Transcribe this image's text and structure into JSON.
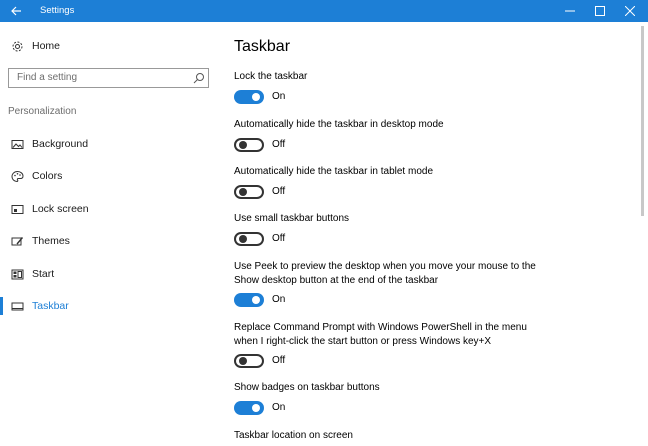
{
  "window": {
    "title": "Settings",
    "accent": "#1d7fd6"
  },
  "sidebar": {
    "home_label": "Home",
    "search_placeholder": "Find a setting",
    "section_label": "Personalization",
    "items": [
      {
        "label": "Background",
        "icon": "picture-icon",
        "selected": false
      },
      {
        "label": "Colors",
        "icon": "palette-icon",
        "selected": false
      },
      {
        "label": "Lock screen",
        "icon": "lock-screen-icon",
        "selected": false
      },
      {
        "label": "Themes",
        "icon": "brush-icon",
        "selected": false
      },
      {
        "label": "Start",
        "icon": "start-icon",
        "selected": false
      },
      {
        "label": "Taskbar",
        "icon": "taskbar-icon",
        "selected": true
      }
    ]
  },
  "main": {
    "title": "Taskbar",
    "settings": [
      {
        "label": "Lock the taskbar",
        "state": "On"
      },
      {
        "label": "Automatically hide the taskbar in desktop mode",
        "state": "Off"
      },
      {
        "label": "Automatically hide the taskbar in tablet mode",
        "state": "Off"
      },
      {
        "label": "Use small taskbar buttons",
        "state": "Off"
      },
      {
        "label": "Use Peek to preview the desktop when you move your mouse to the Show desktop button at the end of the taskbar",
        "state": "On"
      },
      {
        "label": "Replace Command Prompt with Windows PowerShell in the menu when I right-click the start button or press Windows key+X",
        "state": "Off"
      },
      {
        "label": "Show badges on taskbar buttons",
        "state": "On"
      }
    ],
    "next_heading": "Taskbar location on screen"
  }
}
